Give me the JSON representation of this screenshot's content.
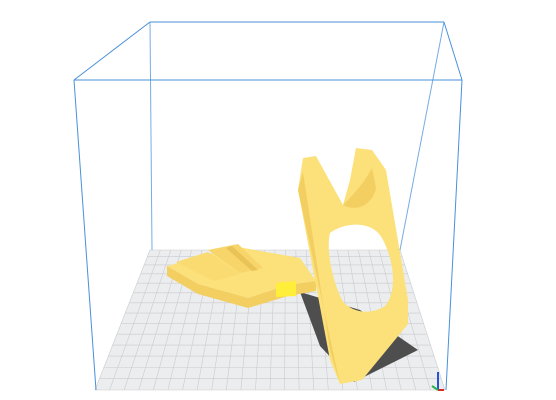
{
  "viewport": {
    "background": "#ffffff",
    "build_volume_color": "#4a90d9",
    "plate_color": "#ecedee",
    "grid_color": "#c9ccd0",
    "model_color": "#fce07a",
    "model_shade": "#f3cf62",
    "model_highlight": "#ffef9a",
    "shadow_color": "#4e4e4e",
    "axes": {
      "x_color": "#e0261b",
      "y_color": "#2bb24c",
      "z_color": "#2a52d8"
    }
  },
  "model": {
    "name": "",
    "type": "headphone stand"
  }
}
